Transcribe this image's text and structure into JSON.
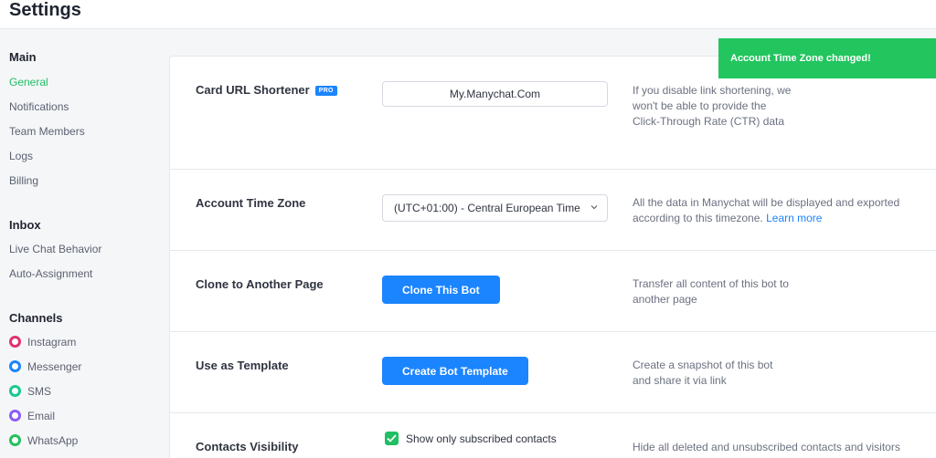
{
  "header": {
    "title": "Settings"
  },
  "sidebar": {
    "sections": [
      {
        "title": "Main",
        "items": [
          {
            "label": "General",
            "active": true
          },
          {
            "label": "Notifications"
          },
          {
            "label": "Team Members"
          },
          {
            "label": "Logs"
          },
          {
            "label": "Billing"
          }
        ]
      },
      {
        "title": "Inbox",
        "items": [
          {
            "label": "Live Chat Behavior"
          },
          {
            "label": "Auto-Assignment"
          }
        ]
      },
      {
        "title": "Channels",
        "items": [
          {
            "label": "Instagram",
            "icon": "instagram-icon",
            "color": "#e1306c"
          },
          {
            "label": "Messenger",
            "icon": "messenger-icon",
            "color": "#1b84ff"
          },
          {
            "label": "SMS",
            "icon": "sms-icon",
            "color": "#18c98d"
          },
          {
            "label": "Email",
            "icon": "email-icon",
            "color": "#8b5cf6"
          },
          {
            "label": "WhatsApp",
            "icon": "whatsapp-icon",
            "color": "#25c05e"
          }
        ]
      }
    ]
  },
  "settings": {
    "url_shortener": {
      "label": "Card URL Shortener",
      "badge": "PRO",
      "value": "My.Manychat.Com",
      "description": "If you disable link shortening, we won't be able to provide the Click-Through Rate (CTR) data"
    },
    "time_zone": {
      "label": "Account Time Zone",
      "selected": "(UTC+01:00) - Central European Time",
      "description": "All the data in Manychat will be displayed and exported according to this timezone.",
      "link": "Learn more"
    },
    "clone": {
      "label": "Clone to Another Page",
      "button": "Clone This Bot",
      "description": "Transfer all content of this bot to another page"
    },
    "template": {
      "label": "Use as Template",
      "button": "Create Bot Template",
      "description": "Create a snapshot of this bot and share it via link"
    },
    "contacts_visibility": {
      "label": "Contacts Visibility",
      "checkbox_label": "Show only subscribed contacts",
      "checked": true,
      "description": "Hide all deleted and unsubscribed contacts and visitors"
    }
  },
  "toast": {
    "message": "Account Time Zone changed!"
  },
  "colors": {
    "accent_blue": "#1b84ff",
    "active_green": "#1fbf63",
    "toast_green": "#22c55e"
  }
}
